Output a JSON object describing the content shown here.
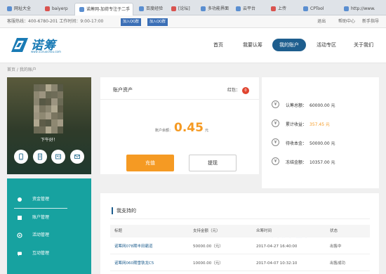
{
  "browser": {
    "tabs": [
      "网址大全",
      "baiyerp",
      "百度经验",
      "[论坛]",
      "多功能界面",
      "云平台",
      "上传",
      "CPTool",
      "http://www.",
      "诺筹网-加荷专注于二手",
      "",
      "",
      ""
    ],
    "active_tab": "诺筹网-加荷专注于二手"
  },
  "infobar": {
    "hotline": "客服热线：400-6780-201   工作时间：9:00-17:00",
    "qq1": "加入QQ群",
    "qq2": "加入QQ群",
    "logout": "退出",
    "help": "帮助中心",
    "newbie": "新手指导"
  },
  "header": {
    "logo_text": "诺筹",
    "logo_sub": "www.51nuochou.com",
    "nav": [
      "首页",
      "我要认筹",
      "我的账户",
      "活动专区",
      "关于我们"
    ],
    "active_nav": "我的账户"
  },
  "breadcrumb": "首页 / 我的账户",
  "profile": {
    "greeting": "下午好！",
    "quick_icons": [
      "phone-icon",
      "document-icon",
      "id-card-icon",
      "email-icon"
    ]
  },
  "menu": {
    "items": [
      "资金管理",
      "账户管理",
      "活动管理",
      "互动管理"
    ]
  },
  "asset": {
    "title": "账户资产",
    "redpacket_label": "红包：",
    "redpacket_count": "0",
    "balance_label": "账户余额：",
    "balance_value": "0.45",
    "balance_unit": "元",
    "recharge": "充值",
    "withdraw": "提现"
  },
  "stats": [
    {
      "label": "认筹总额：",
      "value": "60000.00 元"
    },
    {
      "label": "累计收益：",
      "value": "357.45 元",
      "highlight": true
    },
    {
      "label": "待收本金：",
      "value": "50000.00 元"
    },
    {
      "label": "冻结金额：",
      "value": "10357.00 元"
    }
  ],
  "support": {
    "title": "我支持的",
    "watermark": "百度经验",
    "columns": [
      "标题",
      "支持金额（元）",
      "众筹时间",
      "状态"
    ],
    "rows": [
      [
        "诺筹网078期丰田霸道",
        "50000.00（元）",
        "2017-04-27 16:40:00",
        "出售中"
      ],
      [
        "诺筹网060期雪铁龙C5",
        "10000.00（元）",
        "2017-04-07 10:32:10",
        "出售成功"
      ]
    ]
  },
  "colors": {
    "brand_blue": "#1e5e8e",
    "teal": "#17a2a0",
    "orange": "#f59a23",
    "red_badge": "#e0442f"
  }
}
